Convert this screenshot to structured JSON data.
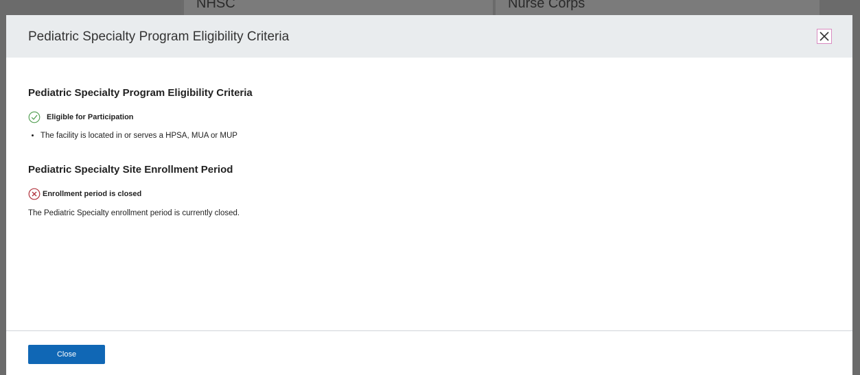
{
  "background": {
    "tabs": [
      "",
      "NHSC",
      "Nurse Corps"
    ]
  },
  "modal": {
    "title": "Pediatric Specialty Program Eligibility Criteria",
    "close_icon": "close-x-icon",
    "eligibility": {
      "heading": "Pediatric Specialty Program Eligibility Criteria",
      "status_icon": "check-circle-icon",
      "status_color": "#4a9a4a",
      "status_label": "Eligible for Participation",
      "bullets": [
        "The facility is located in or serves a HPSA, MUA or MUP"
      ]
    },
    "enrollment": {
      "heading": "Pediatric Specialty Site Enrollment Period",
      "status_icon": "x-circle-icon",
      "status_color": "#b0303a",
      "status_label": "Enrollment period is closed",
      "message": "The Pediatric Specialty enrollment period is currently closed."
    },
    "footer": {
      "close_label": "Close",
      "button_color": "#1067b5"
    }
  }
}
